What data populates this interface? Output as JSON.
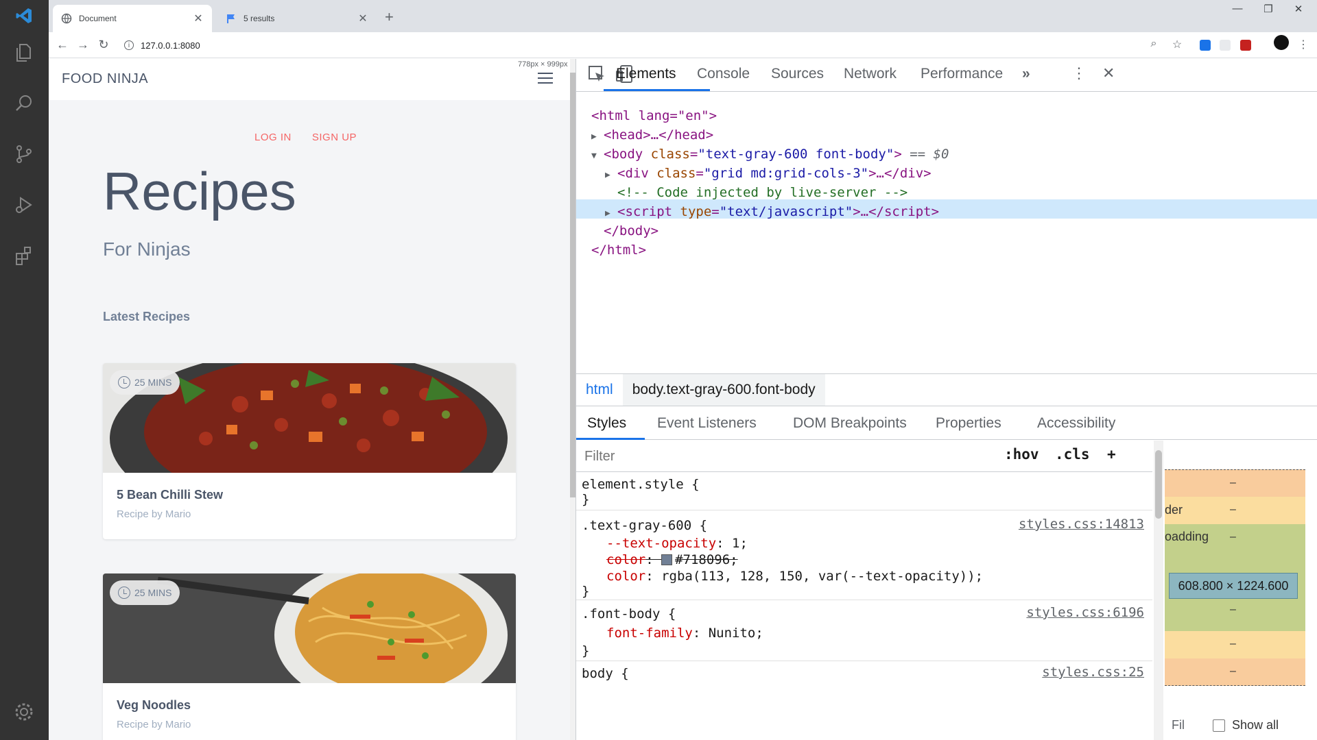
{
  "vscode": {
    "icons": [
      "vscode-logo-icon",
      "explorer-icon",
      "search-icon",
      "source-control-icon",
      "run-debug-icon",
      "extensions-icon",
      "settings-gear-icon"
    ]
  },
  "browser": {
    "tabs": [
      {
        "label": "Document",
        "active": true
      },
      {
        "label": "5 results",
        "active": false
      }
    ],
    "url": "127.0.0.1:8080"
  },
  "page": {
    "dims": "778px × 999px",
    "brand": "FOOD NINJA",
    "login": "LOG IN",
    "signup": "SIGN UP",
    "title": "Recipes",
    "subtitle": "For Ninjas",
    "section": "Latest Recipes",
    "cards": [
      {
        "time": "25 MINS",
        "title": "5 Bean Chilli Stew",
        "by": "Recipe by Mario"
      },
      {
        "time": "25 MINS",
        "title": "Veg Noodles",
        "by": "Recipe by Mario"
      }
    ]
  },
  "devtools": {
    "tabs": [
      "Elements",
      "Console",
      "Sources",
      "Network",
      "Performance"
    ],
    "more": "»",
    "dom": {
      "html_open": "<html lang=\"en\">",
      "head": "<head>…</head>",
      "body_tag": "body",
      "body_class_attr": "class",
      "body_class_val": "\"text-gray-600 font-body\"",
      "body_eq": "== $0",
      "div_attr": "class",
      "div_val": "\"grid md:grid-cols-3\"",
      "comment": "<!-- Code injected by live-server -->",
      "script_attr": "type",
      "script_val": "\"text/javascript\"",
      "body_close": "</body>",
      "html_close": "</html>"
    },
    "breadcrumbs": [
      "html",
      "body.text-gray-600.font-body"
    ],
    "subtabs": [
      "Styles",
      "Event Listeners",
      "DOM Breakpoints",
      "Properties",
      "Accessibility"
    ],
    "filter_placeholder": "Filter",
    "hov": ":hov",
    "cls": ".cls",
    "plus": "+",
    "rules": {
      "element_style": "element.style {",
      "close": "}",
      "r1_selector": ".text-gray-600 {",
      "r1_source": "styles.css:14813",
      "r1_p1_name": "--text-opacity",
      "r1_p1_val": ": 1;",
      "r1_p2_name": "color",
      "r1_p2_val": "#718096;",
      "r1_p3_name": "color",
      "r1_p3_val": ": rgba(113, 128, 150, var(--text-opacity));",
      "r2_selector": ".font-body {",
      "r2_source": "styles.css:6196",
      "r2_p1_name": "font-family",
      "r2_p1_val": ": Nunito;",
      "r3_selector": "body {",
      "r3_source": "styles.css:25"
    },
    "boxmodel": {
      "border_label": "der",
      "padding_label": "oadding",
      "dash": "–",
      "content": "608.800 × 1224.600",
      "filter": "Fil",
      "show_all": "Show all"
    }
  },
  "colors": {
    "accent": "#1a73e8",
    "brand_link": "#f56565",
    "text_gray_600": "#718096"
  }
}
